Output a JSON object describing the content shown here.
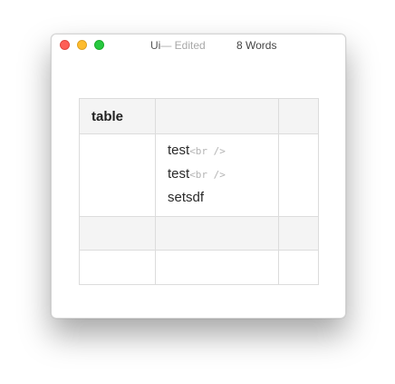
{
  "window": {
    "doc_name": "Ui",
    "edited_label": "— Edited",
    "word_count": "8 Words"
  },
  "table": {
    "header_cell": "table",
    "lines": [
      {
        "text": "test",
        "tag": "<br />"
      },
      {
        "text": "test",
        "tag": "<br />"
      },
      {
        "text": "setsdf",
        "tag": ""
      }
    ]
  },
  "colors": {
    "close": "#fe5f57",
    "minimize": "#febc2e",
    "maximize": "#28c840",
    "shaded_row": "#f4f4f4",
    "tag_text": "#b4b4b4"
  },
  "icons": [
    "close-window-icon",
    "minimize-window-icon",
    "maximize-window-icon"
  ]
}
